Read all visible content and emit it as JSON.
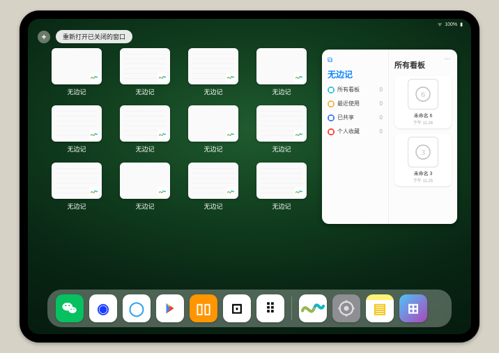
{
  "status": {
    "battery": "100%",
    "wifi": "•"
  },
  "topbar": {
    "close_glyph": "+",
    "reopen_label": "重新打开已关闭的窗口"
  },
  "grid": {
    "app_label": "无边记",
    "tiles": [
      {
        "variant": "blank"
      },
      {
        "variant": "cal"
      },
      {
        "variant": "cal"
      },
      {
        "variant": "blank"
      },
      {
        "variant": "cal"
      },
      {
        "variant": "cal"
      },
      {
        "variant": "blank"
      },
      {
        "variant": "cal"
      },
      {
        "variant": "cal"
      },
      {
        "variant": "blank"
      },
      {
        "variant": "cal"
      },
      {
        "variant": "cal"
      }
    ]
  },
  "panel": {
    "title": "无边记",
    "ellipsis": "…",
    "items": [
      {
        "label": "所有看板",
        "count": "0",
        "color": "cyan"
      },
      {
        "label": "最近使用",
        "count": "0",
        "color": "yellow"
      },
      {
        "label": "已共享",
        "count": "0",
        "color": "blue"
      },
      {
        "label": "个人收藏",
        "count": "0",
        "color": "red"
      }
    ],
    "right_title": "所有看板",
    "cards": [
      {
        "name": "未命名 6",
        "sub": "下午 11:26",
        "glyph": "6"
      },
      {
        "name": "未命名 3",
        "sub": "下午 11:25",
        "glyph": "3"
      }
    ]
  },
  "dock": {
    "icons": [
      {
        "name": "wechat",
        "bg": "#07c160",
        "fg": "#fff",
        "glyph": "●●"
      },
      {
        "name": "quark",
        "bg": "#ffffff",
        "fg": "#1a3cff",
        "glyph": "◉"
      },
      {
        "name": "browser",
        "bg": "#ffffff",
        "fg": "#2aa3f0",
        "glyph": "◯"
      },
      {
        "name": "play",
        "bg": "#ffffff",
        "fg": "#34c759",
        "glyph": "▸"
      },
      {
        "name": "books",
        "bg": "#ff9500",
        "fg": "#fff",
        "glyph": "▯▯"
      },
      {
        "name": "dice",
        "bg": "#ffffff",
        "fg": "#000",
        "glyph": "⊡"
      },
      {
        "name": "grid",
        "bg": "#ffffff",
        "fg": "#000",
        "glyph": "⠿"
      },
      {
        "name": "freeform",
        "bg": "#ffffff",
        "fg": "#0aa",
        "glyph": "∿"
      },
      {
        "name": "settings",
        "bg": "#8e8e93",
        "fg": "#ddd",
        "glyph": "⚙"
      },
      {
        "name": "notes",
        "bg": "#ffffff",
        "fg": "#f5c518",
        "glyph": "▤"
      },
      {
        "name": "recents",
        "bg": "linear",
        "fg": "#fff",
        "glyph": "⊞"
      }
    ]
  }
}
